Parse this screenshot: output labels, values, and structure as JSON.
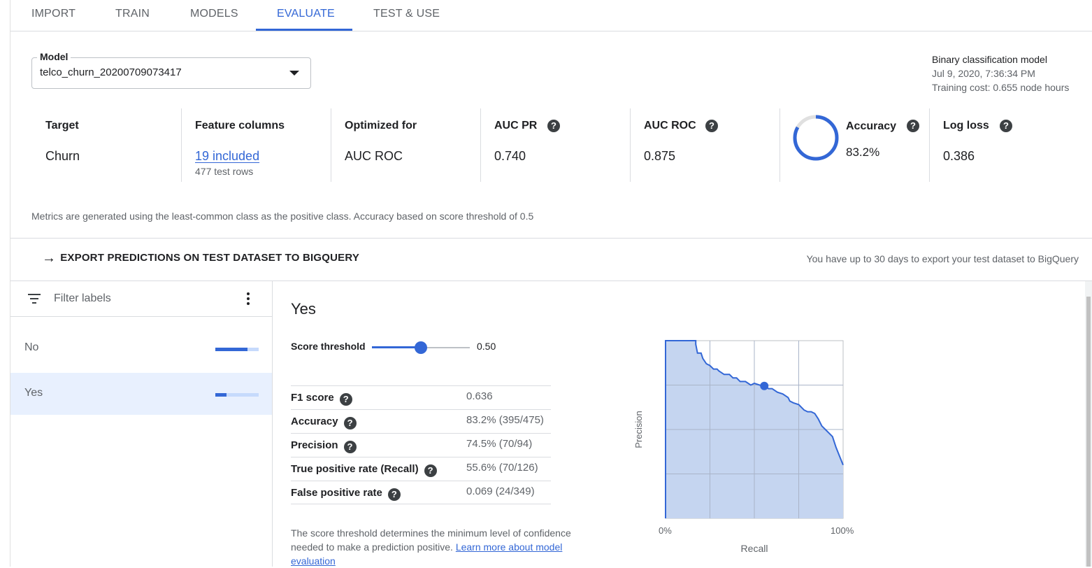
{
  "tabs": [
    {
      "label": "IMPORT"
    },
    {
      "label": "TRAIN"
    },
    {
      "label": "MODELS"
    },
    {
      "label": "EVALUATE",
      "active": true
    },
    {
      "label": "TEST & USE"
    }
  ],
  "model": {
    "legend": "Model",
    "value": "telco_churn_20200709073417"
  },
  "model_meta": {
    "type": "Binary classification model",
    "date": "Jul 9, 2020, 7:36:34 PM",
    "cost": "Training cost: 0.655 node hours"
  },
  "metrics": {
    "target": {
      "label": "Target",
      "value": "Churn"
    },
    "features": {
      "label": "Feature columns",
      "value": "19 included",
      "sub": "477 test rows"
    },
    "optimized": {
      "label": "Optimized for",
      "value": "AUC ROC"
    },
    "auc_pr": {
      "label": "AUC PR",
      "value": "0.740"
    },
    "auc_roc": {
      "label": "AUC ROC",
      "value": "0.875"
    },
    "accuracy": {
      "label": "Accuracy",
      "value": "83.2%",
      "ring_fraction": 0.832
    },
    "log_loss": {
      "label": "Log loss",
      "value": "0.386"
    }
  },
  "note": "Metrics are generated using the least-common class as the positive class. Accuracy based on score threshold of 0.5",
  "export": {
    "label": "EXPORT PREDICTIONS ON TEST DATASET TO BIGQUERY",
    "note": "You have up to 30 days to export your test dataset to BigQuery"
  },
  "labels_panel": {
    "filter_placeholder": "Filter labels",
    "items": [
      {
        "label": "No",
        "fraction": 0.74
      },
      {
        "label": "Yes",
        "fraction": 0.26,
        "selected": true
      }
    ]
  },
  "detail": {
    "title": "Yes",
    "threshold_label": "Score threshold",
    "threshold_value": "0.50",
    "threshold_fraction": 0.5,
    "stats": [
      {
        "label": "F1 score",
        "value": "0.636"
      },
      {
        "label": "Accuracy",
        "value": "83.2% (395/475)"
      },
      {
        "label": "Precision",
        "value": "74.5% (70/94)"
      },
      {
        "label": "True positive rate (Recall)",
        "value": "55.6% (70/126)"
      },
      {
        "label": "False positive rate",
        "value": "0.069 (24/349)"
      }
    ],
    "description": "The score threshold determines the minimum level of confidence needed to make a prediction positive.",
    "learn_more": "Learn more about model evaluation"
  },
  "colors": {
    "accent": "#3367d6",
    "chart_fill": "#c5d5f0",
    "chart_line": "#3367d6",
    "ring_track": "#e0e0e0"
  },
  "chart_data": {
    "type": "area",
    "title": "",
    "xlabel": "Recall",
    "ylabel": "Precision",
    "x_tick_labels": [
      "0%",
      "100%"
    ],
    "xlim": [
      0,
      1
    ],
    "ylim": [
      0,
      1
    ],
    "grid": true,
    "series": [
      {
        "x": [
          0,
          0,
          0.01,
          0.17,
          0.17,
          0.18,
          0.2,
          0.21,
          0.23,
          0.25,
          0.27,
          0.29,
          0.3,
          0.33,
          0.36,
          0.38,
          0.4,
          0.42,
          0.45,
          0.48,
          0.5,
          0.53,
          0.556,
          0.58,
          0.6,
          0.63,
          0.66,
          0.69,
          0.7,
          0.72,
          0.75,
          0.78,
          0.8,
          0.82,
          0.84,
          0.86,
          0.88,
          0.9,
          0.92,
          0.94,
          0.96,
          0.98,
          1.0
        ],
        "y": [
          0,
          1.0,
          1.0,
          1.0,
          0.98,
          0.93,
          0.93,
          0.9,
          0.87,
          0.86,
          0.84,
          0.84,
          0.83,
          0.81,
          0.81,
          0.79,
          0.79,
          0.77,
          0.77,
          0.75,
          0.76,
          0.75,
          0.745,
          0.73,
          0.73,
          0.71,
          0.7,
          0.68,
          0.66,
          0.65,
          0.64,
          0.61,
          0.6,
          0.6,
          0.59,
          0.56,
          0.52,
          0.5,
          0.48,
          0.46,
          0.4,
          0.35,
          0.3
        ]
      }
    ],
    "highlight_point": {
      "x": 0.556,
      "y": 0.745
    }
  }
}
